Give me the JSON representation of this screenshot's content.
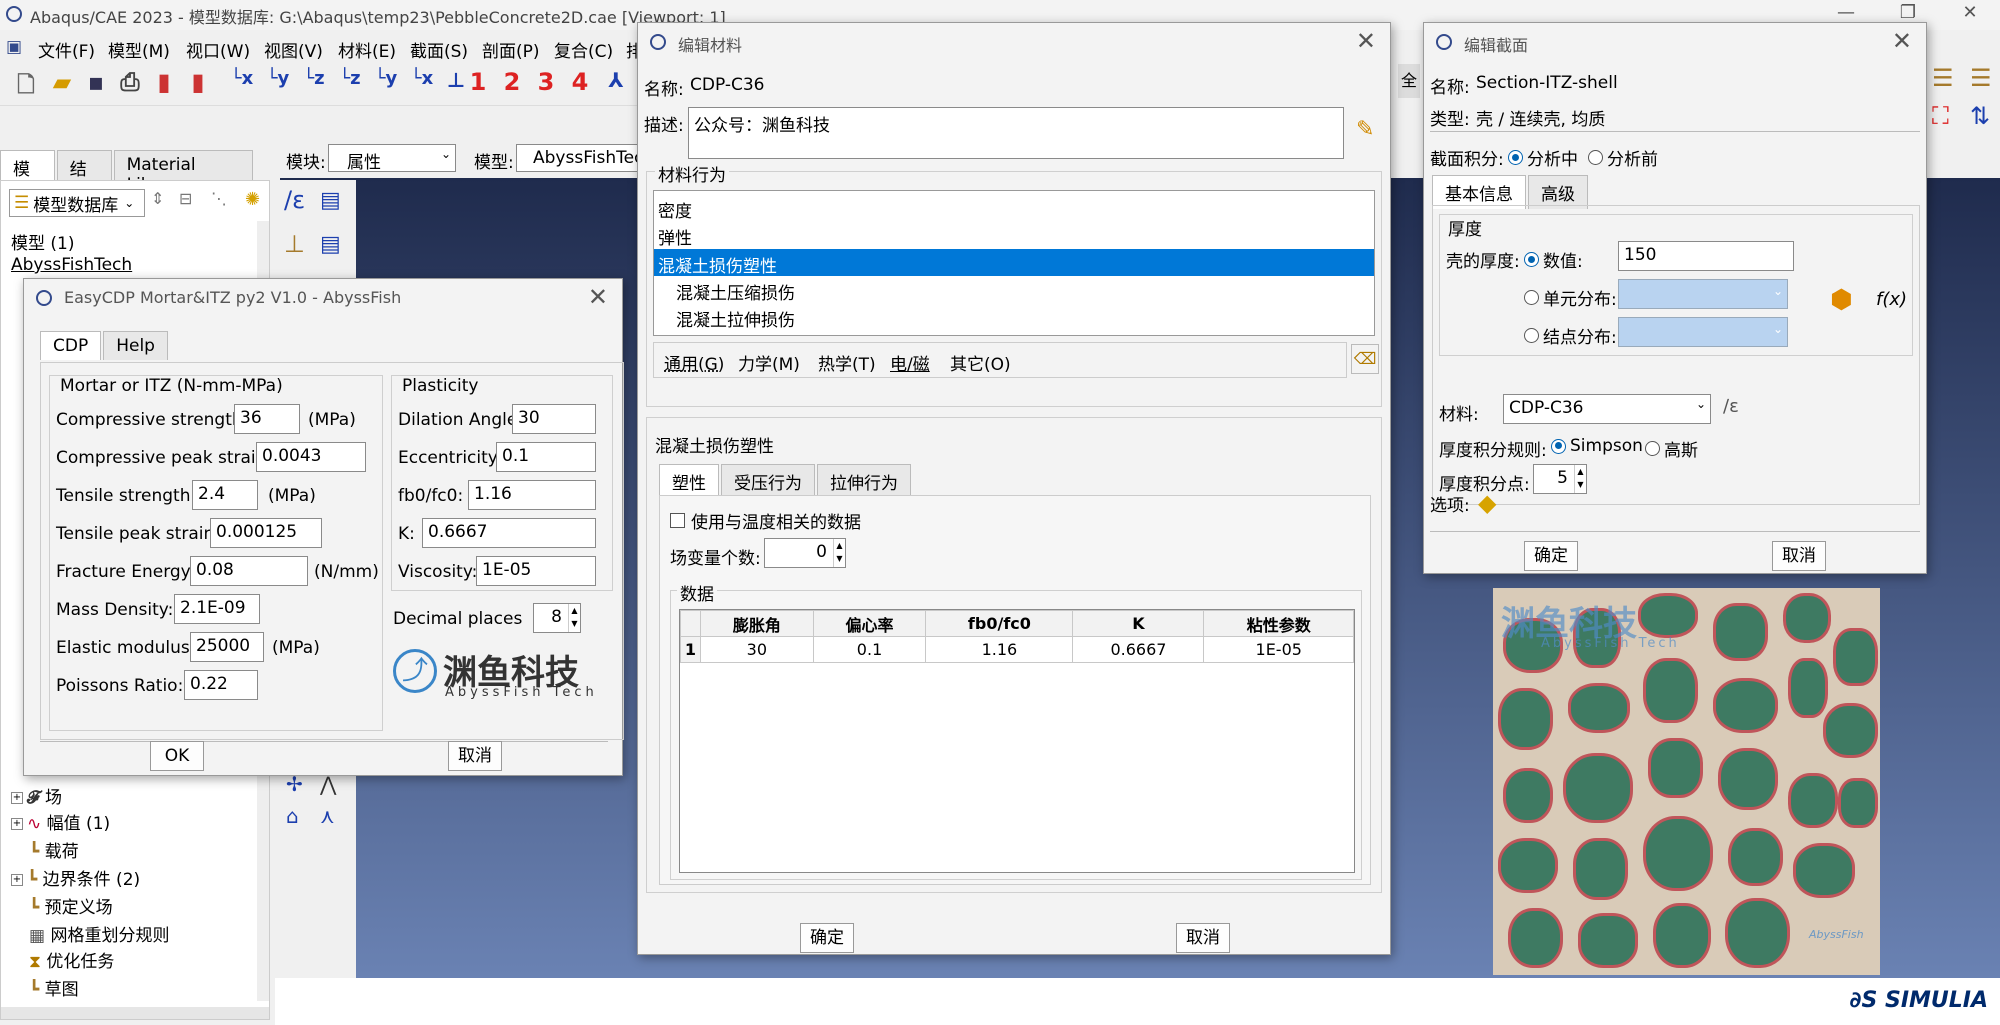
{
  "app": {
    "title": "Abaqus/CAE 2023 - 模型数据库: G:\\Abaqus\\temp23\\PebbleConcrete2D.cae [Viewport: 1]",
    "menu": [
      "文件(F)",
      "模型(M)",
      "视口(W)",
      "视图(V)",
      "材料(E)",
      "截面(S)",
      "剖面(P)",
      "复合(C)",
      "排"
    ],
    "toolbar_digits": [
      "1",
      "2",
      "3",
      "4"
    ],
    "module_label": "模块:",
    "module_value": "属性",
    "model_label": "模型:",
    "model_value": "AbyssFishTech",
    "tree_tabs": [
      "模型",
      "结果",
      "Material Library"
    ],
    "tree_db": "模型数据库",
    "tree_root": "模型 (1)",
    "tree_model": "AbyssFishTech",
    "tree_items": [
      {
        "label": "场"
      },
      {
        "label": "幅值 (1)"
      },
      {
        "label": "载荷"
      },
      {
        "label": "边界条件 (2)"
      },
      {
        "label": "预定义场"
      },
      {
        "label": "网格重划分规则"
      },
      {
        "label": "优化任务"
      },
      {
        "label": "草图"
      }
    ],
    "full_btn": "全",
    "simulia": "SIMULIA",
    "watermark_cn": "渊鱼科技",
    "watermark_en": "AbyssFish Tech",
    "watermark_small": "AbyssFish"
  },
  "cdp_dialog": {
    "title": "EasyCDP Mortar&ITZ py2 V1.0 - AbyssFish",
    "tabs": [
      "CDP",
      "Help"
    ],
    "mortar_group": "Mortar or ITZ (N-mm-MPa)",
    "fields": [
      {
        "label": "Compressive strength:",
        "value": "36",
        "unit": "(MPa)"
      },
      {
        "label": "Compressive peak strain:",
        "value": "0.0043",
        "unit": ""
      },
      {
        "label": "Tensile strength:",
        "value": "2.4",
        "unit": "(MPa)"
      },
      {
        "label": "Tensile peak strain:",
        "value": "0.000125",
        "unit": ""
      },
      {
        "label": "Fracture Energy:",
        "value": "0.08",
        "unit": "(N/mm)"
      },
      {
        "label": "Mass Density:",
        "value": "2.1E-09",
        "unit": ""
      },
      {
        "label": "Elastic modulus:",
        "value": "25000",
        "unit": "(MPa)"
      },
      {
        "label": "Poissons Ratio:",
        "value": "0.22",
        "unit": ""
      }
    ],
    "plasticity_group": "Plasticity",
    "plasticity": [
      {
        "label": "Dilation Angle:",
        "value": "30"
      },
      {
        "label": "Eccentricity:",
        "value": "0.1"
      },
      {
        "label": "fb0/fc0:",
        "value": "1.16"
      },
      {
        "label": "K:",
        "value": "0.6667"
      },
      {
        "label": "Viscosity:",
        "value": "1E-05"
      }
    ],
    "decimal_label": "Decimal places",
    "decimal_value": "8",
    "logo_cn": "渊鱼科技",
    "logo_en": "AbyssFish Tech",
    "ok": "OK",
    "cancel": "取消"
  },
  "material_dialog": {
    "title": "编辑材料",
    "name_label": "名称:",
    "name_value": "CDP-C36",
    "desc_label": "描述:",
    "desc_value": "公众号：渊鱼科技",
    "behavior_label": "材料行为",
    "behaviors": [
      "密度",
      "弹性",
      "混凝土损伤塑性",
      "混凝土压缩损伤",
      "混凝土拉伸损伤"
    ],
    "menu": [
      "通用(G)",
      "力学(M)",
      "热学(T)",
      "电/磁",
      "其它(O)"
    ],
    "section_label": "混凝土损伤塑性",
    "subtabs": [
      "塑性",
      "受压行为",
      "拉伸行为"
    ],
    "temp_check": "使用与温度相关的数据",
    "field_var_label": "场变量个数:",
    "field_var_value": "0",
    "data_label": "数据",
    "columns": [
      "膨胀角",
      "偏心率",
      "fb0/fc0",
      "K",
      "粘性参数"
    ],
    "rows": [
      {
        "idx": "1",
        "cells": [
          "30",
          "0.1",
          "1.16",
          "0.6667",
          "1E-05"
        ]
      }
    ],
    "ok": "确定",
    "cancel": "取消"
  },
  "section_dialog": {
    "title": "编辑截面",
    "name_label": "名称:",
    "name_value": "Section-ITZ-shell",
    "type_label": "类型:",
    "type_value": "壳 / 连续壳, 均质",
    "integ_label": "截面积分:",
    "integ_options": [
      "分析中",
      "分析前"
    ],
    "tabs": [
      "基本信息",
      "高级"
    ],
    "thickness_group": "厚度",
    "shell_thk_label": "壳的厚度:",
    "thk_options": [
      "数值:",
      "单元分布:",
      "结点分布:"
    ],
    "thk_value": "150",
    "fx": "f(x)",
    "material_label": "材料:",
    "material_value": "CDP-C36",
    "rule_label": "厚度积分规则:",
    "rule_options": [
      "Simpson",
      "高斯"
    ],
    "points_label": "厚度积分点:",
    "points_value": "5",
    "options_label": "选项:",
    "ok": "确定",
    "cancel": "取消"
  },
  "colors": {
    "selection": "#0078d7",
    "pebble": "#3e7a62",
    "itz": "#c0555a",
    "mortar": "#d9cbb8"
  }
}
